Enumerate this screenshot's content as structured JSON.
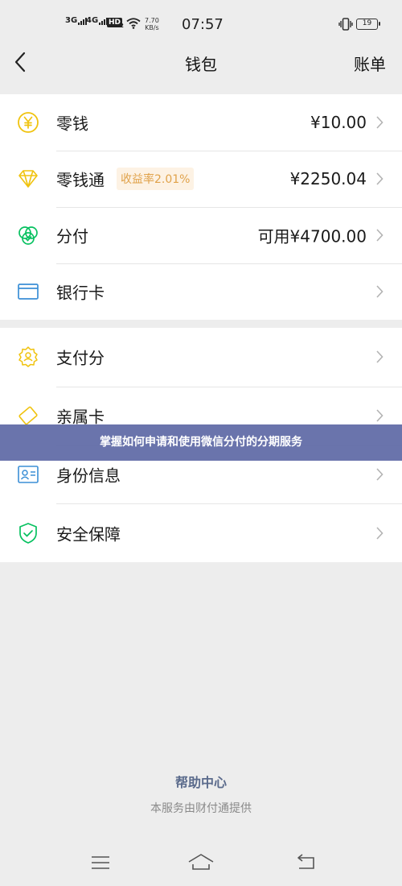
{
  "status_bar": {
    "sim1": "3G",
    "sim2": "4G",
    "hd": "HD",
    "hd_sub": "2",
    "speed_value": "7.70",
    "speed_unit": "KB/s",
    "time": "07:57",
    "battery": "19"
  },
  "nav": {
    "title": "钱包",
    "right_label": "账单"
  },
  "group1": {
    "items": [
      {
        "label": "零钱",
        "value": "¥10.00",
        "icon": "yuan-circle-icon"
      },
      {
        "label": "零钱通",
        "badge": "收益率2.01%",
        "value": "¥2250.04",
        "icon": "diamond-icon"
      },
      {
        "label": "分付",
        "value": "可用¥4700.00",
        "icon": "fenfu-icon"
      },
      {
        "label": "银行卡",
        "value": "",
        "icon": "bank-card-icon"
      }
    ]
  },
  "group2": {
    "items": [
      {
        "label": "支付分",
        "icon": "pay-score-icon"
      },
      {
        "label": "亲属卡",
        "icon": "family-card-icon"
      },
      {
        "label": "身份信息",
        "icon": "id-card-icon"
      },
      {
        "label": "安全保障",
        "icon": "shield-icon"
      }
    ]
  },
  "banner": "掌握如何申请和使用微信分付的分期服务",
  "footer": {
    "help": "帮助中心",
    "provided": "本服务由财付通提供"
  },
  "colors": {
    "background": "#ededed",
    "gold": "#f0c30f",
    "green": "#07c160",
    "blue": "#3b8fd6",
    "badge_bg": "#fdf2e4",
    "badge_text": "#e0a24a",
    "banner": "#626da8",
    "help_link": "#5b6b8c"
  },
  "system_nav": [
    "menu-icon",
    "home-icon",
    "back-return-icon"
  ]
}
